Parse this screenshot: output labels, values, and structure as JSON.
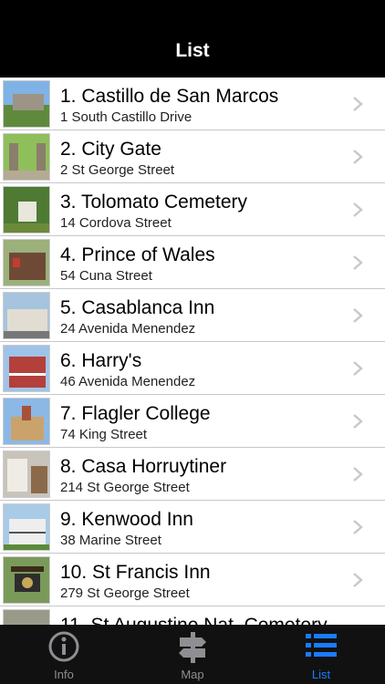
{
  "nav": {
    "title": "List"
  },
  "items": [
    {
      "title": "1. Castillo de San Marcos",
      "address": "1 South Castillo Drive"
    },
    {
      "title": "2. City Gate",
      "address": "2 St George Street"
    },
    {
      "title": "3. Tolomato Cemetery",
      "address": "14 Cordova Street"
    },
    {
      "title": "4. Prince of Wales",
      "address": "54 Cuna Street"
    },
    {
      "title": "5. Casablanca Inn",
      "address": "24 Avenida Menendez"
    },
    {
      "title": "6. Harry's",
      "address": "46 Avenida Menendez"
    },
    {
      "title": "7. Flagler College",
      "address": "74 King Street"
    },
    {
      "title": "8. Casa Horruytiner",
      "address": "214 St George Street"
    },
    {
      "title": "9. Kenwood Inn",
      "address": "38 Marine Street"
    },
    {
      "title": "10. St Francis Inn",
      "address": "279 St George Street"
    },
    {
      "title": "11. St Augustine Nat. Cemetery",
      "address": ""
    }
  ],
  "tabs": [
    {
      "label": "Info",
      "icon": "info-icon",
      "active": false
    },
    {
      "label": "Map",
      "icon": "signpost-icon",
      "active": false
    },
    {
      "label": "List",
      "icon": "list-icon",
      "active": true
    }
  ],
  "colors": {
    "accent": "#1a7cff",
    "inactive": "#8e8e93",
    "bar": "#000000"
  }
}
